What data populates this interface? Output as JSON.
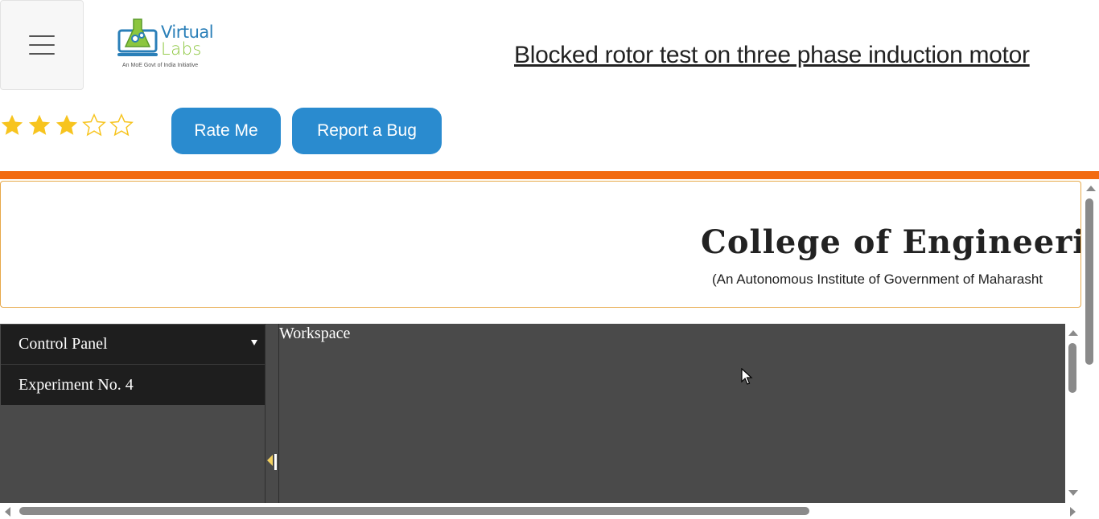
{
  "header": {
    "menu_icon": "hamburger-icon",
    "logo": {
      "line1": "Virtual",
      "line2": "Labs",
      "tagline": "An MoE Govt of India Initiative"
    },
    "title": "Blocked rotor test on three phase induction motor"
  },
  "rating": {
    "value": 3,
    "max": 5,
    "filled_color": "#f7c41f",
    "empty_color": "#f7c41f"
  },
  "buttons": {
    "rate_me": "Rate Me",
    "report_bug": "Report a Bug",
    "color": "#2a8bcf"
  },
  "accent_bar_color": "#f26a10",
  "banner": {
    "title": "College of Engineering, P",
    "subtitle": "(An Autonomous Institute of Government of Maharasht"
  },
  "app": {
    "sidebar": {
      "control_panel": "Control Panel",
      "experiment": "Experiment No. 4"
    },
    "workspace_label": "Workspace"
  }
}
